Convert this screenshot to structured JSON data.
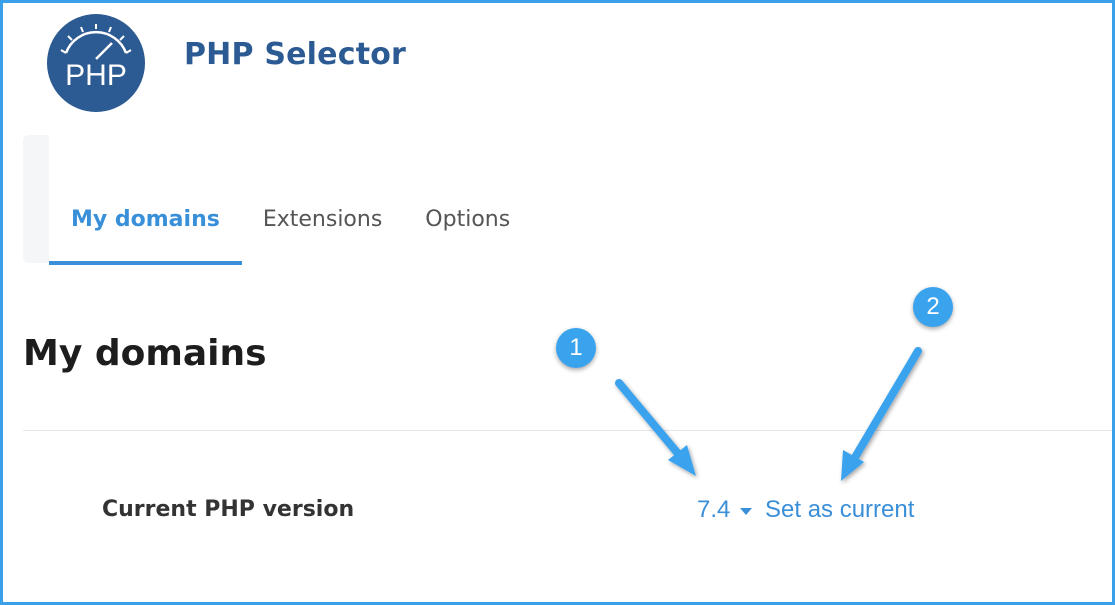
{
  "logo": {
    "text": "PHP",
    "icon": "php-gauge-icon",
    "color": "#2c5a92"
  },
  "app": {
    "title": "PHP Selector"
  },
  "tabs": [
    {
      "label": "My domains",
      "active": true
    },
    {
      "label": "Extensions",
      "active": false
    },
    {
      "label": "Options",
      "active": false
    }
  ],
  "section": {
    "title": "My domains"
  },
  "row": {
    "label": "Current PHP version",
    "version": "7.4",
    "action": "Set as current"
  },
  "annotations": [
    {
      "number": "1",
      "points_to": "version-dropdown"
    },
    {
      "number": "2",
      "points_to": "set-as-current-link"
    }
  ],
  "colors": {
    "accent": "#3a8fd9",
    "frame": "#3aa0ea",
    "title": "#2c5a92",
    "badge": "#3aa3ee"
  }
}
